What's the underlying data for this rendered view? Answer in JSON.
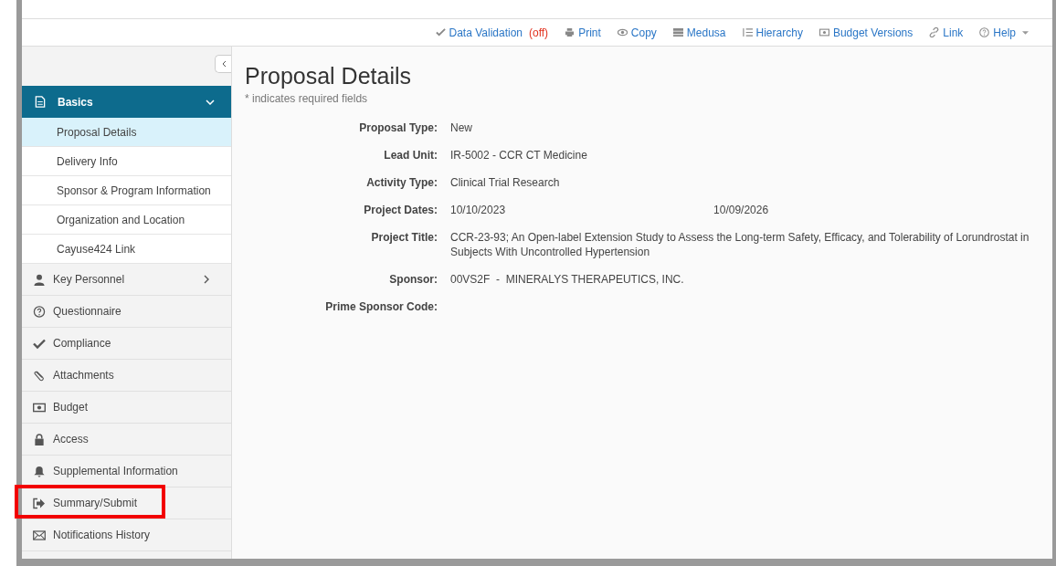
{
  "toolbar": [
    {
      "label": "Data Validation",
      "status": "(off)"
    },
    {
      "label": "Print"
    },
    {
      "label": "Copy"
    },
    {
      "label": "Medusa"
    },
    {
      "label": "Hierarchy"
    },
    {
      "label": "Budget Versions"
    },
    {
      "label": "Link"
    },
    {
      "label": "Help",
      "dropdown": true
    }
  ],
  "sidebar": {
    "items": [
      {
        "label": "Basics",
        "expanded": true,
        "children": [
          {
            "label": "Proposal Details",
            "selected": true
          },
          {
            "label": "Delivery Info",
            "selected": false
          },
          {
            "label": "Sponsor & Program Information",
            "selected": false
          },
          {
            "label": "Organization and Location",
            "selected": false
          },
          {
            "label": "Cayuse424 Link",
            "selected": false
          }
        ]
      },
      {
        "label": "Key Personnel",
        "expanded": false,
        "highlighted": false
      },
      {
        "label": "Questionnaire",
        "highlighted": false
      },
      {
        "label": "Compliance",
        "highlighted": false
      },
      {
        "label": "Attachments",
        "highlighted": false
      },
      {
        "label": "Budget",
        "highlighted": false
      },
      {
        "label": "Access",
        "highlighted": false
      },
      {
        "label": "Supplemental Information",
        "highlighted": false
      },
      {
        "label": "Summary/Submit",
        "highlighted": true
      },
      {
        "label": "Notifications History",
        "highlighted": false
      }
    ]
  },
  "main": {
    "title": "Proposal Details",
    "note": "* indicates required fields",
    "fields": [
      {
        "label": "Proposal Type:",
        "values": [
          "New"
        ]
      },
      {
        "label": "Lead Unit:",
        "values": [
          "IR-5002 - CCR CT Medicine"
        ]
      },
      {
        "label": "Activity Type:",
        "values": [
          "Clinical Trial Research"
        ]
      },
      {
        "label": "Project Dates:",
        "values": [
          "10/10/2023",
          "10/09/2026"
        ]
      },
      {
        "label": "Project Title:",
        "values": [
          "CCR-23-93; An Open-label Extension Study to Assess the Long-term Safety, Efficacy, and Tolerability of Lorundrostat in Subjects With Uncontrolled Hypertension"
        ]
      },
      {
        "label": "Sponsor:",
        "values": [
          "00VS2F  -  MINERALYS THERAPEUTICS, INC."
        ]
      },
      {
        "label": "Prime Sponsor Code:"
      }
    ]
  }
}
